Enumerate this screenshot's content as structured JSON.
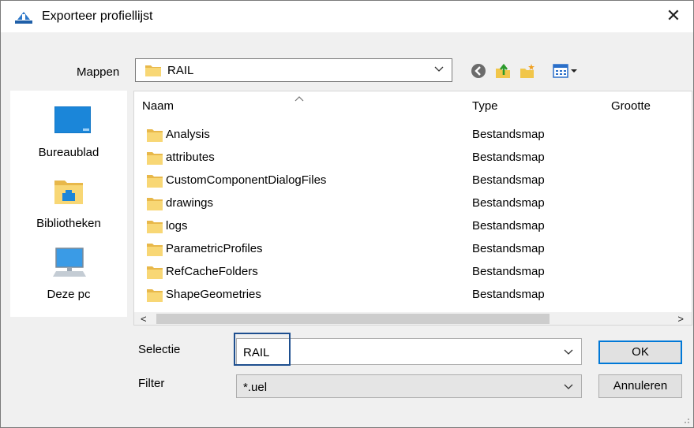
{
  "window": {
    "title": "Exporteer profiellijst",
    "close_glyph": "✕"
  },
  "folder_bar": {
    "label": "Mappen",
    "current": "RAIL"
  },
  "toolbar": {
    "icons": [
      "back-icon",
      "up-folder-icon",
      "new-folder-icon",
      "view-menu-icon"
    ]
  },
  "places": [
    {
      "label": "Bureaublad",
      "icon": "desktop-icon"
    },
    {
      "label": "Bibliotheken",
      "icon": "libraries-icon"
    },
    {
      "label": "Deze pc",
      "icon": "this-pc-icon"
    }
  ],
  "file_list": {
    "columns": {
      "name": "Naam",
      "type": "Type",
      "size": "Grootte"
    },
    "sort_glyph": "^",
    "rows": [
      {
        "name": "Analysis",
        "type": "Bestandsmap"
      },
      {
        "name": "attributes",
        "type": "Bestandsmap"
      },
      {
        "name": "CustomComponentDialogFiles",
        "type": "Bestandsmap"
      },
      {
        "name": "drawings",
        "type": "Bestandsmap"
      },
      {
        "name": "logs",
        "type": "Bestandsmap"
      },
      {
        "name": "ParametricProfiles",
        "type": "Bestandsmap"
      },
      {
        "name": "RefCacheFolders",
        "type": "Bestandsmap"
      },
      {
        "name": "ShapeGeometries",
        "type": "Bestandsmap"
      }
    ],
    "scroll_left": "<",
    "scroll_right": ">"
  },
  "selection": {
    "label": "Selectie",
    "value": "RAIL"
  },
  "filter": {
    "label": "Filter",
    "value": "*.uel"
  },
  "buttons": {
    "ok": "OK",
    "cancel": "Annuleren"
  },
  "colors": {
    "accent": "#0078d7",
    "folder": "#f8d775",
    "selection_outline": "#1e4f8f"
  }
}
